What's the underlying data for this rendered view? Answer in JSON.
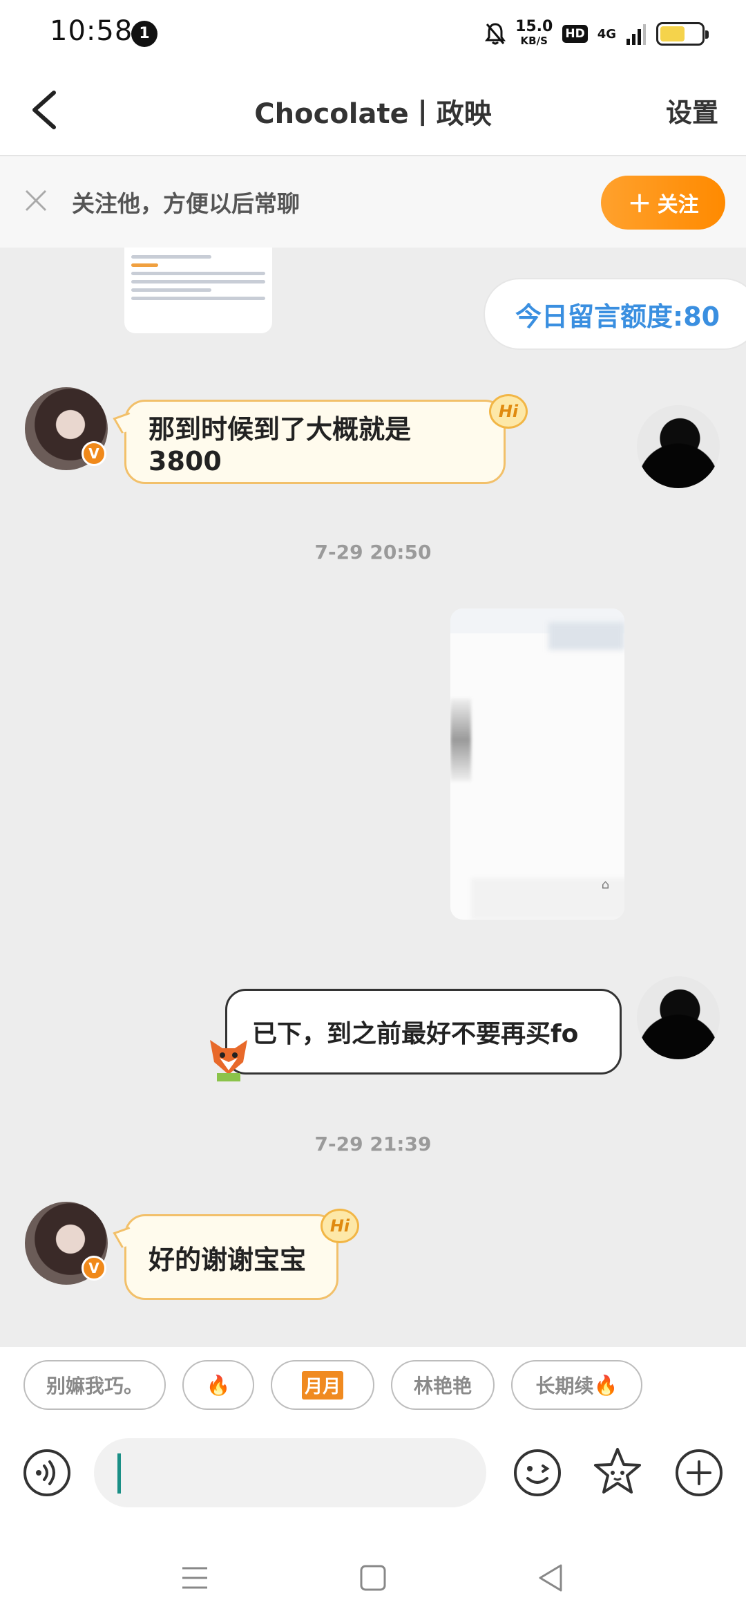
{
  "status_bar": {
    "time": "10:58",
    "notification_count": "1",
    "net_speed": "15.0",
    "net_unit": "KB/S",
    "hd": "HD",
    "signal": "4G",
    "battery_level": 0.6
  },
  "header": {
    "back_icon": "chevron-left-icon",
    "title": "Chocolate丨政映",
    "settings_label": "设置"
  },
  "follow_banner": {
    "close_icon": "close-icon",
    "text": "关注他，方便以后常聊",
    "button_plus": "+",
    "button_label": "关注"
  },
  "chat": {
    "quota_label": "今日留言额度:80",
    "messages": [
      {
        "side": "left",
        "text": "那到时候到了大概就是3800",
        "badge": "Hi",
        "verified": "V"
      },
      {
        "type": "timestamp",
        "text": "7-29 20:50"
      },
      {
        "side": "right",
        "type": "image",
        "blurred": true
      },
      {
        "side": "right",
        "text": "已下，到之前最好不要再买fo"
      },
      {
        "type": "timestamp",
        "text": "7-29 21:39"
      },
      {
        "side": "left",
        "text": "好的谢谢宝宝",
        "badge": "Hi",
        "verified": "V"
      }
    ]
  },
  "quick_chips": [
    {
      "label": "别嫲我巧。"
    },
    {
      "label": "🔥"
    },
    {
      "label": "月月"
    },
    {
      "label": "林艳艳"
    },
    {
      "label": "长期续"
    }
  ],
  "input": {
    "voice_icon": "voice-icon",
    "value": "",
    "emoji_icon": "emoji-icon",
    "sticker_icon": "star-sticker-icon",
    "plus_icon": "plus-circle-icon"
  },
  "nav": {
    "menu_icon": "menu-icon",
    "home_icon": "home-square-icon",
    "back_icon": "back-triangle-icon"
  },
  "colors": {
    "accent_orange": "#ff8a00",
    "quota_blue": "#3a8fe0",
    "bubble_left_border": "#f2c06a",
    "bubble_left_bg": "#fffbed",
    "caret": "#1a8f86"
  }
}
